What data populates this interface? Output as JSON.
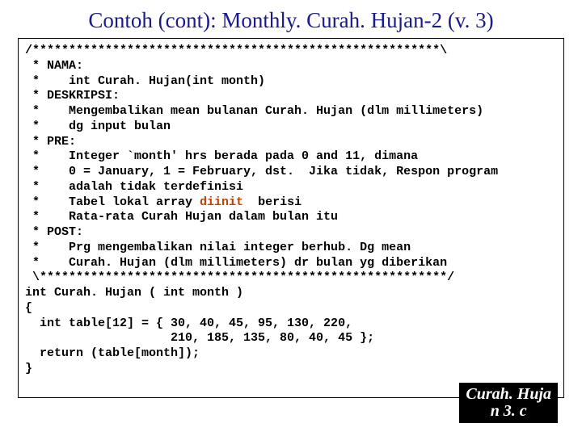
{
  "title": "Contoh (cont): Monthly. Curah. Hujan-2 (v. 3)",
  "code": {
    "l01": "/********************************************************\\",
    "l02": " * NAMA:",
    "l03": " *    int Curah. Hujan(int month)",
    "l04": " * DESKRIPSI:",
    "l05": " *    Mengembalikan mean bulanan Curah. Hujan (dlm millimeters)",
    "l06": " *    dg input bulan",
    "l07": " * PRE:",
    "l08": " *    Integer `month' hrs berada pada 0 and 11, dimana",
    "l09": " *    0 = January, 1 = February, dst.  Jika tidak, Respon program",
    "l10": " *    adalah tidak terdefinisi",
    "l11a": " *    Tabel lokal array ",
    "l11b": "diinit",
    "l11c": "  berisi",
    "l12": " *    Rata-rata Curah Hujan dalam bulan itu",
    "l13": " * POST:",
    "l14": " *    Prg mengembalikan nilai integer berhub. Dg mean",
    "l15": " *    Curah. Hujan (dlm millimeters) dr bulan yg diberikan",
    "l16": " \\********************************************************/",
    "l17": "int Curah. Hujan ( int month )",
    "l18": "{",
    "l19": "  int table[12] = { 30, 40, 45, 95, 130, 220,",
    "l20": "                    210, 185, 135, 80, 40, 45 };",
    "l21": "  return (table[month]);",
    "l22": "}"
  },
  "label_line1": "Curah. Huja",
  "label_line2": "n 3. c"
}
